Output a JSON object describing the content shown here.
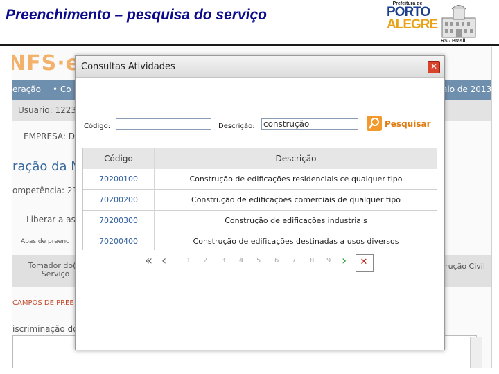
{
  "slide": {
    "title": "Preenchimento – pesquisa do serviço",
    "logo": {
      "line1": "Prefeitura de",
      "line2": "PORTO",
      "line3": "ALEGRE",
      "region": "RS - Brasil"
    }
  },
  "background_app": {
    "logo_text": "NFS·e",
    "nav": [
      "eração",
      "• Co",
      "aio de 2013"
    ],
    "user_label": "Usuario: 12236",
    "company_label": "EMPRESA: D",
    "heading": "ração da NF",
    "competencia": "ompetência: 21/",
    "liberar": "Liberar a ass",
    "abas": "Abas de preenc",
    "tab_left": "Tomador do(s) Serviço",
    "tab_right": "strução Civil",
    "campos": "CAMPOS DE PREE",
    "discriminacao": "iscriminação do("
  },
  "modal": {
    "title": "Consultas Atividades",
    "codigo_label": "Código:",
    "codigo_value": "",
    "descricao_label": "Descrição:",
    "descricao_value": "construção",
    "search_label": "Pesquisar",
    "table": {
      "headers": [
        "Código",
        "Descrição"
      ],
      "rows": [
        {
          "code": "70200100",
          "desc": "Construção de edificações residenciais ce qualquer tipo"
        },
        {
          "code": "70200200",
          "desc": "Construção de edificações comerciais de qualquer tipo"
        },
        {
          "code": "70200300",
          "desc": "Construção de edificações industriais"
        },
        {
          "code": "70200400",
          "desc": "Construção de edificações destinadas a usos diversos"
        }
      ]
    },
    "pagination": {
      "pages": [
        "1",
        "2",
        "3",
        "4",
        "5",
        "6",
        "7",
        "8",
        "9"
      ],
      "current": "1"
    }
  }
}
